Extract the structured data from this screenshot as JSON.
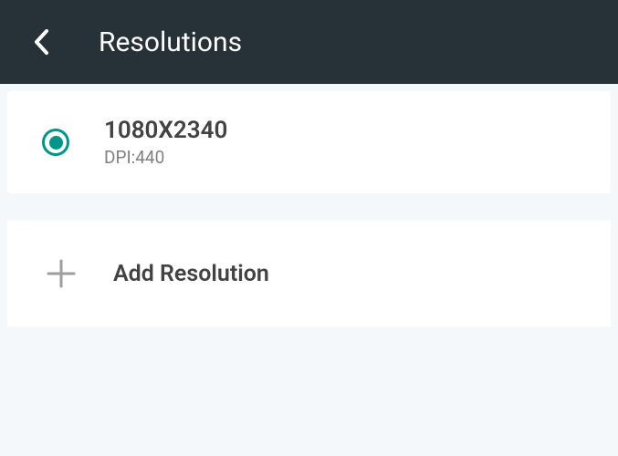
{
  "header": {
    "title": "Resolutions"
  },
  "resolutions": [
    {
      "value": "1080X2340",
      "dpi": "DPI:440",
      "selected": true
    }
  ],
  "actions": {
    "add_label": "Add Resolution"
  },
  "colors": {
    "header_bg": "#263238",
    "accent": "#009688",
    "page_bg": "#f5f8fb"
  }
}
